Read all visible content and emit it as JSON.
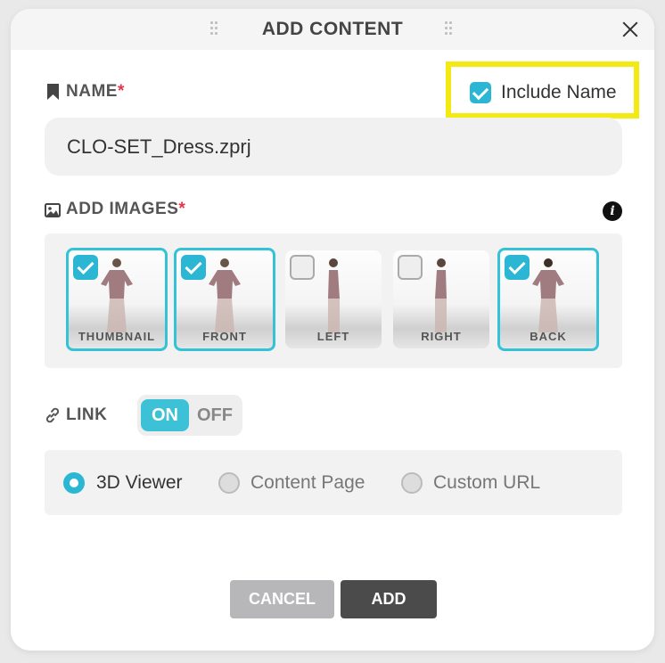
{
  "dialog": {
    "title": "ADD CONTENT",
    "close_icon": "close-icon"
  },
  "name_section": {
    "label": "NAME",
    "required_mark": "*",
    "icon": "bookmark-icon",
    "include_name": {
      "label": "Include Name",
      "checked": true
    },
    "value": "CLO-SET_Dress.zprj"
  },
  "images_section": {
    "label": "ADD IMAGES",
    "required_mark": "*",
    "icon": "image-icon",
    "info_icon": "info-icon",
    "info_glyph": "i",
    "images": [
      {
        "caption": "THUMBNAIL",
        "checked": true
      },
      {
        "caption": "FRONT",
        "checked": true
      },
      {
        "caption": "LEFT",
        "checked": false
      },
      {
        "caption": "RIGHT",
        "checked": false
      },
      {
        "caption": "BACK",
        "checked": true
      }
    ]
  },
  "link_section": {
    "label": "LINK",
    "icon": "link-icon",
    "toggle": {
      "on_label": "ON",
      "off_label": "OFF",
      "state": "ON"
    },
    "options": [
      {
        "label": "3D Viewer",
        "selected": true
      },
      {
        "label": "Content Page",
        "selected": false
      },
      {
        "label": "Custom URL",
        "selected": false
      }
    ]
  },
  "buttons": {
    "cancel": "CANCEL",
    "add": "ADD"
  },
  "colors": {
    "accent": "#2bb7d3",
    "highlight": "#f4ea13",
    "required": "#e8334a",
    "add_button": "#4b4b4b",
    "cancel_button": "#b7b7b9"
  }
}
